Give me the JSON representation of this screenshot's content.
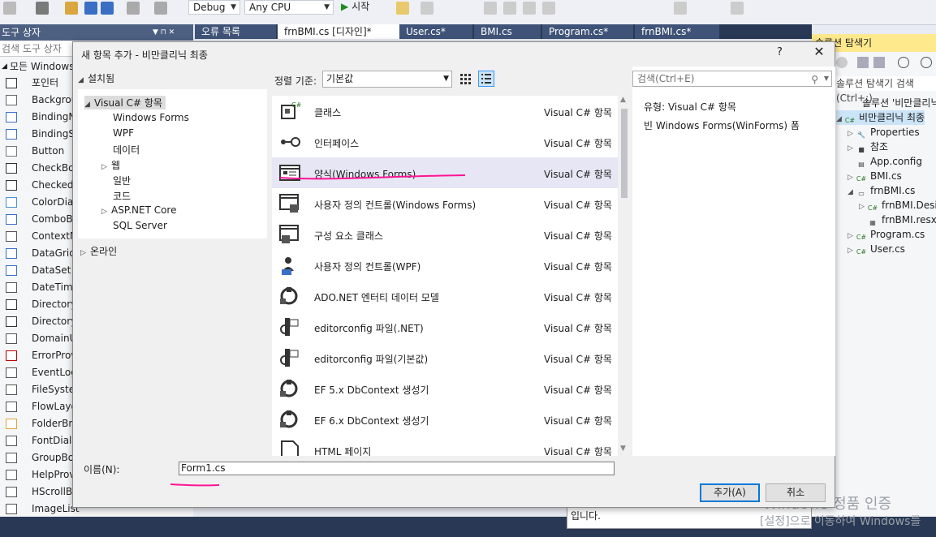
{
  "toolbar": {
    "config_value": "Debug",
    "platform_value": "Any CPU",
    "start_label": "시작"
  },
  "doc_tabs": [
    "오류 목록",
    "frnBMI.cs [디자인]*",
    "User.cs*",
    "BMI.cs",
    "Program.cs*",
    "frnBMI.cs*"
  ],
  "toolbox": {
    "title": "도구 상자",
    "search_placeholder": "검색 도구 상자",
    "group": "모든 Windows",
    "items": [
      "포인터",
      "BackgroundWorker",
      "BindingNavigator",
      "BindingSource",
      "Button",
      "CheckBox",
      "CheckedListBox",
      "ColorDialog",
      "ComboBox",
      "ContextMenuStrip",
      "DataGridView",
      "DataSet",
      "DateTimePicker",
      "DirectoryEntry",
      "DirectorySearcher",
      "DomainUpDown",
      "ErrorProvider",
      "EventLog",
      "FileSystemWatcher",
      "FlowLayoutPanel",
      "FolderBrowserDialog",
      "FontDialog",
      "GroupBox",
      "HelpProvider",
      "HScrollBar",
      "ImageList"
    ]
  },
  "solution_explorer": {
    "title": "솔루션 탐색기",
    "search_placeholder": "솔루션 탐색기 검색(Ctrl+;)",
    "items": [
      {
        "label": "솔루션 '비만클리닉 최종",
        "icon": "solution-icon"
      },
      {
        "label": "비만클리닉 최종",
        "icon": "csharp-project-icon"
      },
      {
        "label": "Properties",
        "icon": "wrench-icon"
      },
      {
        "label": "참조",
        "icon": "references-icon"
      },
      {
        "label": "App.config",
        "icon": "config-file-icon"
      },
      {
        "label": "BMI.cs",
        "icon": "csharp-file-icon"
      },
      {
        "label": "frnBMI.cs",
        "icon": "form-icon"
      },
      {
        "label": "frnBMI.Designer.cs",
        "icon": "csharp-file-icon"
      },
      {
        "label": "frnBMI.resx",
        "icon": "resx-icon"
      },
      {
        "label": "Program.cs",
        "icon": "csharp-file-icon"
      },
      {
        "label": "User.cs",
        "icon": "csharp-file-icon"
      }
    ]
  },
  "dialog": {
    "title": "새 항목 추가 - 비만클리닉 최종",
    "help": "?",
    "close": "✕",
    "installed_label": "설치됨",
    "tree": {
      "root": "Visual C# 항목",
      "children": [
        "Windows Forms",
        "WPF",
        "데이터",
        "웹",
        "일반",
        "코드",
        "ASP.NET Core",
        "SQL Server"
      ],
      "online": "온라인"
    },
    "sort_label": "정렬 기준:",
    "sort_value": "기본값",
    "search_placeholder": "검색(Ctrl+E)",
    "templates": [
      {
        "name": "클래스",
        "category": "Visual C# 항목",
        "icon": "class-icon"
      },
      {
        "name": "인터페이스",
        "category": "Visual C# 항목",
        "icon": "interface-icon"
      },
      {
        "name": "양식(Windows Forms)",
        "category": "Visual C# 항목",
        "icon": "form-icon"
      },
      {
        "name": "사용자 정의 컨트롤(Windows Forms)",
        "category": "Visual C# 항목",
        "icon": "user-control-icon"
      },
      {
        "name": "구성 요소 클래스",
        "category": "Visual C# 항목",
        "icon": "component-class-icon"
      },
      {
        "name": "사용자 정의 컨트롤(WPF)",
        "category": "Visual C# 항목",
        "icon": "wpf-user-control-icon"
      },
      {
        "name": "ADO.NET 엔터티 데이터 모델",
        "category": "Visual C# 항목",
        "icon": "data-model-icon"
      },
      {
        "name": "editorconfig 파일(.NET)",
        "category": "Visual C# 항목",
        "icon": "editorconfig-icon"
      },
      {
        "name": "editorconfig 파일(기본값)",
        "category": "Visual C# 항목",
        "icon": "editorconfig-icon"
      },
      {
        "name": "EF 5.x DbContext 생성기",
        "category": "Visual C# 항목",
        "icon": "generator-icon"
      },
      {
        "name": "EF 6.x DbContext 생성기",
        "category": "Visual C# 항목",
        "icon": "generator-icon"
      },
      {
        "name": "HTML 페이지",
        "category": "Visual C# 항목",
        "icon": "html-page-icon"
      }
    ],
    "selected_index": 2,
    "detail": {
      "type_label": "유형:",
      "type_value": "Visual C# 항목",
      "description": "빈 Windows Forms(WinForms) 폼"
    },
    "name_label": "이름(N):",
    "name_value": "Form1.cs",
    "add_button": "추가(A)",
    "cancel_button": "취소"
  },
  "watermark": {
    "line1": "Windows 정품 인증",
    "line2": "[설정]으로 이동하여 Windows를"
  },
  "tooltip_fragment": "입니다.",
  "colors": {
    "ide_dark": "#293955",
    "dialog_bg": "#f0f0f0",
    "selected_row": "#e6e6f5",
    "accent_blue": "#0078d7",
    "annotation_magenta": "#ff1493"
  }
}
